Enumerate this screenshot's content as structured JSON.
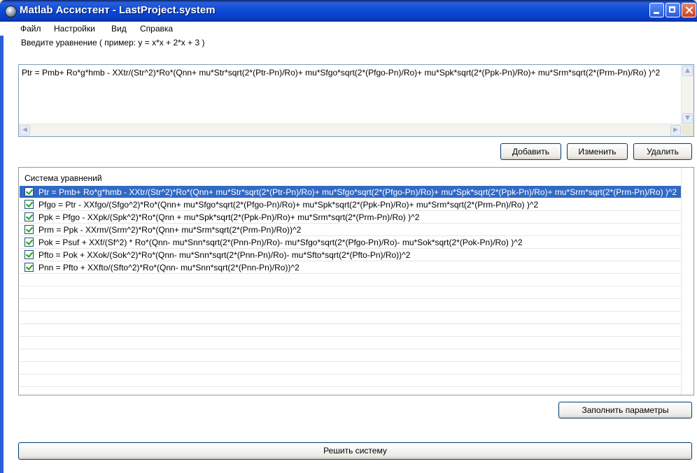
{
  "window": {
    "title": "Matlab Ассистент - LastProject.system"
  },
  "menu": [
    "Файл",
    "Настройки",
    "Вид",
    "Справка"
  ],
  "input": {
    "label": "Введите уравнение ( пример: y = x*x + 2*x + 3 )",
    "value": "Ptr = Pmb+ Ro*g*hmb - XXtr/(Str^2)*Ro*(Qnn+ mu*Str*sqrt(2*(Ptr-Pn)/Ro)+ mu*Sfgo*sqrt(2*(Pfgo-Pn)/Ro)+ mu*Spk*sqrt(2*(Ppk-Pn)/Ro)+ mu*Srm*sqrt(2*(Prm-Pn)/Ro) )^2"
  },
  "buttons": {
    "add": "Добавить",
    "edit": "Изменить",
    "delete": "Удалить",
    "fill_params": "Заполнить параметры",
    "solve": "Решить систему"
  },
  "system": {
    "title": "Система уравнений",
    "selected_index": 0,
    "equations": [
      {
        "text": "Ptr = Pmb+ Ro*g*hmb - XXtr/(Str^2)*Ro*(Qnn+ mu*Str*sqrt(2*(Ptr-Pn)/Ro)+ mu*Sfgo*sqrt(2*(Pfgo-Pn)/Ro)+ mu*Spk*sqrt(2*(Ppk-Pn)/Ro)+ mu*Srm*sqrt(2*(Prm-Pn)/Ro) )^2",
        "checked": true
      },
      {
        "text": "Pfgo = Ptr - XXfgo/(Sfgo^2)*Ro*(Qnn+ mu*Sfgo*sqrt(2*(Pfgo-Pn)/Ro)+ mu*Spk*sqrt(2*(Ppk-Pn)/Ro)+ mu*Srm*sqrt(2*(Prm-Pn)/Ro) )^2",
        "checked": true
      },
      {
        "text": "Ppk = Pfgo - XXpk/(Spk^2)*Ro*(Qnn + mu*Spk*sqrt(2*(Ppk-Pn)/Ro)+ mu*Srm*sqrt(2*(Prm-Pn)/Ro) )^2",
        "checked": true
      },
      {
        "text": "Prm = Ppk - XXrm/(Srm^2)*Ro*(Qnn+ mu*Srm*sqrt(2*(Prm-Pn)/Ro))^2",
        "checked": true
      },
      {
        "text": "Pok = Psuf + XXf/(Sf^2) * Ro*(Qnn- mu*Snn*sqrt(2*(Pnn-Pn)/Ro)- mu*Sfgo*sqrt(2*(Pfgo-Pn)/Ro)- mu*Sok*sqrt(2*(Pok-Pn)/Ro) )^2",
        "checked": true
      },
      {
        "text": "Pfto = Pok + XXok/(Sok^2)*Ro*(Qnn- mu*Snn*sqrt(2*(Pnn-Pn)/Ro)- mu*Sfto*sqrt(2*(Pfto-Pn)/Ro))^2",
        "checked": true
      },
      {
        "text": "Pnn = Pfto + XXfto/(Sfto^2)*Ro*(Qnn- mu*Snn*sqrt(2*(Pnn-Pn)/Ro))^2",
        "checked": true
      }
    ],
    "empty_rows": 9
  },
  "colors": {
    "titlebar": "#0a4ad8",
    "selection": "#316ac5",
    "check": "#21a121"
  }
}
